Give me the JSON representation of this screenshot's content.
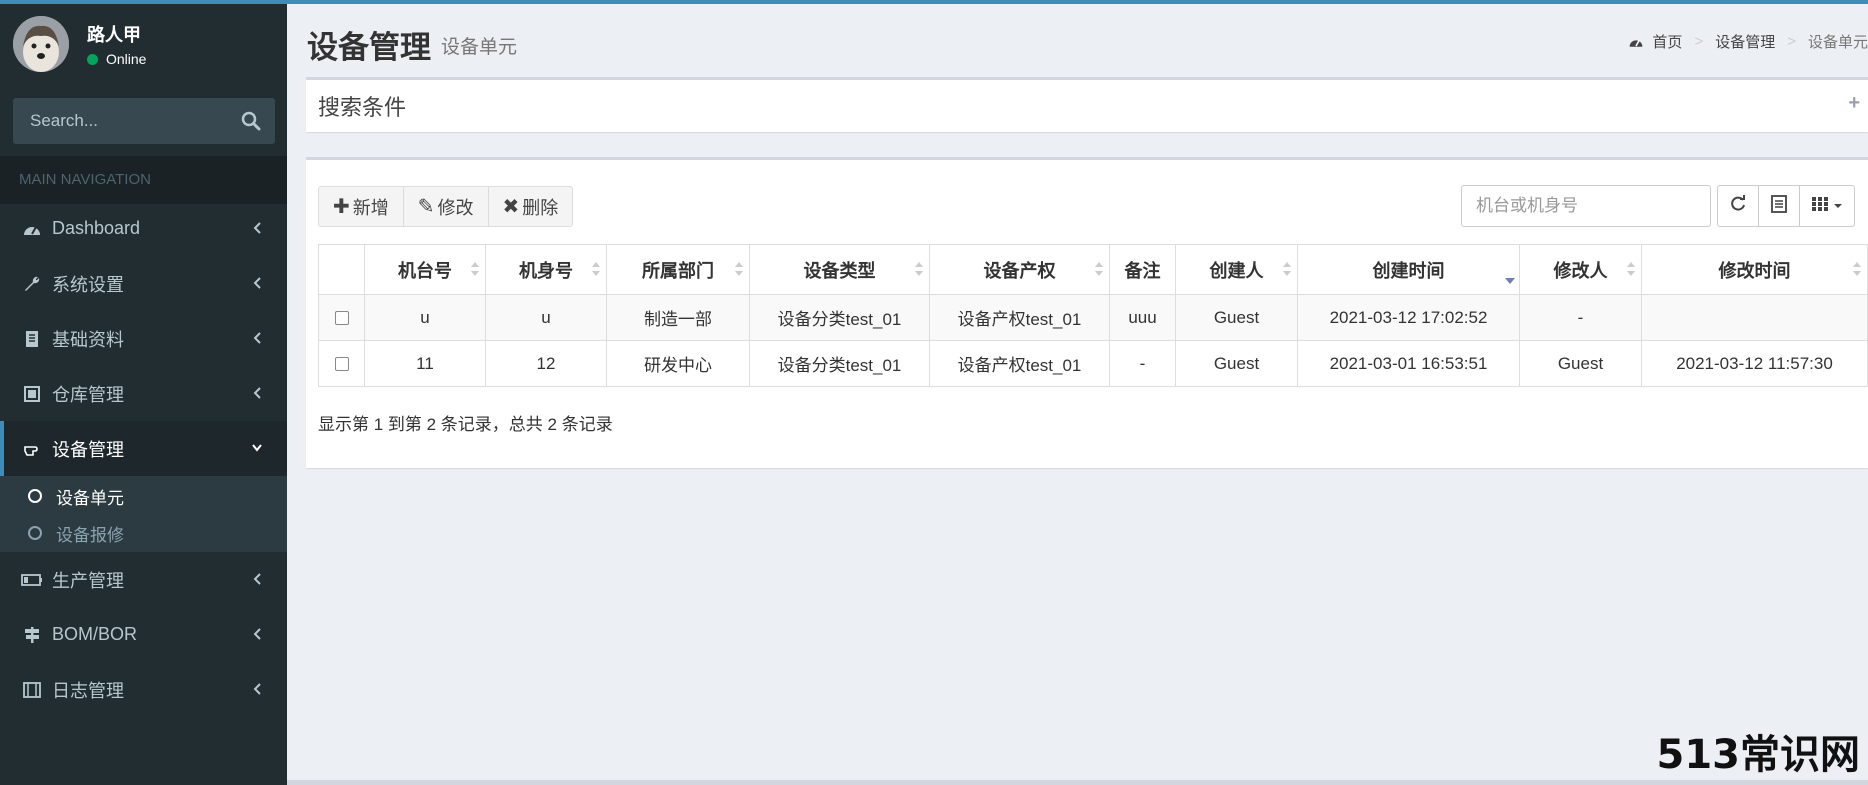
{
  "user": {
    "name": "路人甲",
    "status": "Online"
  },
  "sidebar": {
    "search_placeholder": "Search...",
    "header": "MAIN NAVIGATION",
    "items": [
      {
        "label": "Dashboard",
        "icon": "dashboard-icon"
      },
      {
        "label": "系统设置",
        "icon": "wrench-icon"
      },
      {
        "label": "基础资料",
        "icon": "book-icon"
      },
      {
        "label": "仓库管理",
        "icon": "warehouse-icon"
      },
      {
        "label": "设备管理",
        "icon": "hand-icon"
      },
      {
        "label": "生产管理",
        "icon": "battery-icon"
      },
      {
        "label": "BOM/BOR",
        "icon": "signpost-icon"
      },
      {
        "label": "日志管理",
        "icon": "film-icon"
      }
    ],
    "submenu": [
      {
        "label": "设备单元"
      },
      {
        "label": "设备报修"
      }
    ]
  },
  "header": {
    "title": "设备管理",
    "subtitle": "设备单元",
    "breadcrumb": [
      "首页",
      "设备管理",
      "设备单元"
    ]
  },
  "search_box": {
    "title": "搜索条件",
    "expand": "+"
  },
  "toolbar": {
    "add": "新增",
    "edit": "修改",
    "delete": "删除",
    "search_placeholder": "机台或机身号"
  },
  "table": {
    "columns": [
      "机台号",
      "机身号",
      "所属部门",
      "设备类型",
      "设备产权",
      "备注",
      "创建人",
      "创建时间",
      "修改人",
      "修改时间"
    ],
    "rows": [
      [
        "u",
        "u",
        "制造一部",
        "设备分类test_01",
        "设备产权test_01",
        "uuu",
        "Guest",
        "2021-03-12 17:02:52",
        "-",
        ""
      ],
      [
        "11",
        "12",
        "研发中心",
        "设备分类test_01",
        "设备产权test_01",
        "-",
        "Guest",
        "2021-03-01 16:53:51",
        "Guest",
        "2021-03-12 11:57:30"
      ]
    ],
    "sorted_column": "创建时间",
    "sort_direction": "desc"
  },
  "pagination": {
    "info": "显示第 1 到第 2 条记录，总共 2 条记录"
  },
  "watermark": "513常识网",
  "colors": {
    "sidebar": "#222d32",
    "accent": "#3c8dbc",
    "online": "#00a65a",
    "content_bg": "#ecf0f5"
  }
}
